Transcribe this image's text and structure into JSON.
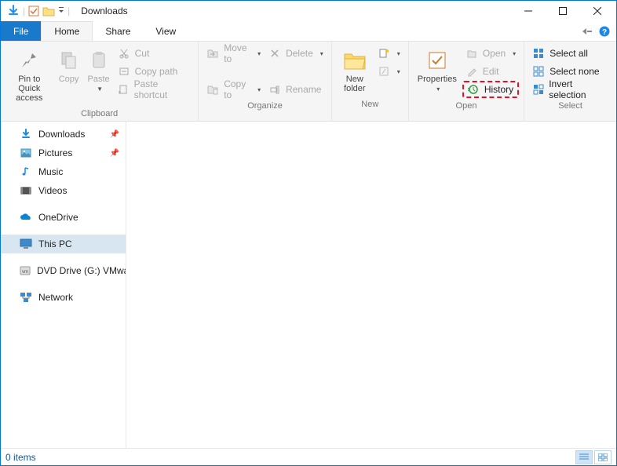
{
  "title": "Downloads",
  "tabs": {
    "file": "File",
    "home": "Home",
    "share": "Share",
    "view": "View"
  },
  "ribbon": {
    "clipboard": {
      "pin": "Pin to Quick\naccess",
      "copy": "Copy",
      "paste": "Paste",
      "cut": "Cut",
      "copy_path": "Copy path",
      "paste_shortcut": "Paste shortcut",
      "group": "Clipboard"
    },
    "organize": {
      "move_to": "Move to",
      "copy_to": "Copy to",
      "delete": "Delete",
      "rename": "Rename",
      "group": "Organize"
    },
    "new": {
      "new_folder": "New\nfolder",
      "group": "New"
    },
    "open": {
      "properties": "Properties",
      "open": "Open",
      "edit": "Edit",
      "history": "History",
      "group": "Open"
    },
    "select": {
      "select_all": "Select all",
      "select_none": "Select none",
      "invert": "Invert selection",
      "group": "Select"
    }
  },
  "nav": {
    "downloads": "Downloads",
    "pictures": "Pictures",
    "music": "Music",
    "videos": "Videos",
    "onedrive": "OneDrive",
    "thispc": "This PC",
    "dvd": "DVD Drive (G:) VMwa",
    "network": "Network"
  },
  "status": {
    "items": "0 items"
  }
}
